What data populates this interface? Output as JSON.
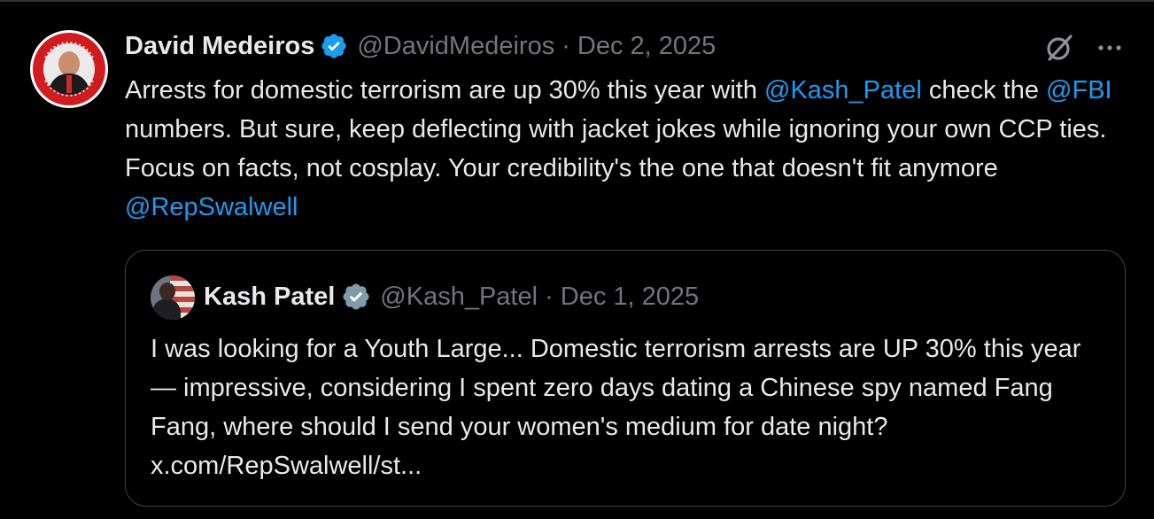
{
  "theme": {
    "background": "#000000",
    "text": "#e7e9ea",
    "secondary_text": "#71767b",
    "accent": "#1d9bf0",
    "border": "#3e4144"
  },
  "tweet": {
    "author_name": "David Medeiros",
    "author_handle": "@DavidMedeiros",
    "separator": "·",
    "date": "Dec 2, 2025",
    "verified": true,
    "avatar_icon": "avatar-badge-logo",
    "body": {
      "part1": "Arrests for domestic terrorism are up 30% this year with ",
      "mention1": "@Kash_Patel",
      "part2": " check the ",
      "mention2": "@FBI",
      "part3": " numbers. But sure, keep deflecting with jacket jokes while ignoring your own CCP ties. Focus on facts, not cosplay. Your credibility's the one that doesn't fit anymore ",
      "mention3": "@RepSwalwell"
    },
    "actions": {
      "grok_icon": "grok-icon",
      "more_icon": "more-options-icon"
    }
  },
  "quoted_tweet": {
    "author_name": "Kash Patel",
    "author_handle": "@Kash_Patel",
    "separator": "·",
    "date": "Dec 1, 2025",
    "verified": true,
    "body": "I was looking for a Youth Large... Domestic terrorism arrests are UP 30% this year — impressive, considering I spent zero days dating a Chinese spy named Fang Fang, where should I send your women's medium for date night? x.com/RepSwalwell/st..."
  }
}
